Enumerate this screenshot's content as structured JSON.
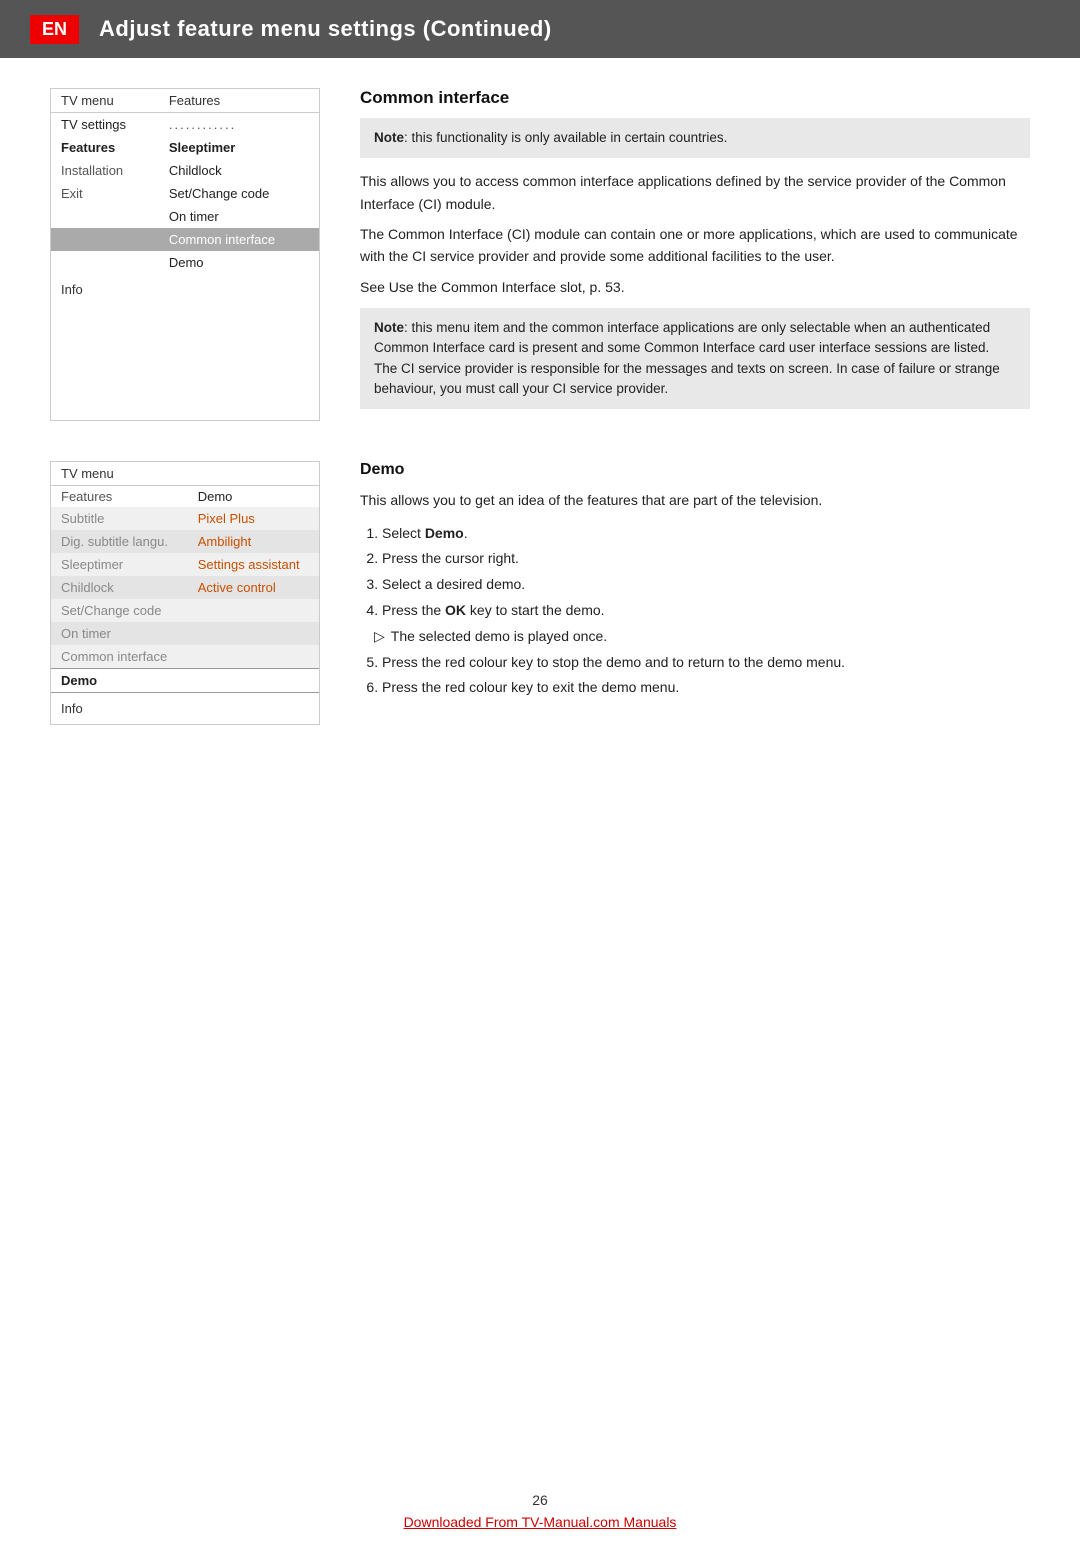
{
  "header": {
    "en_label": "EN",
    "title": "Adjust feature menu settings  (Continued)"
  },
  "section1": {
    "menu": {
      "header": [
        "TV menu",
        "Features"
      ],
      "rows": [
        {
          "left": "TV settings",
          "right": "............",
          "style": "dots"
        },
        {
          "left": "Features",
          "right": "Sleeptimer",
          "style": "features-selected"
        },
        {
          "left": "Installation",
          "right": "Childlock",
          "style": "normal"
        },
        {
          "left": "Exit",
          "right": "Set/Change code",
          "style": "normal"
        },
        {
          "left": "",
          "right": "On timer",
          "style": "normal"
        },
        {
          "left": "",
          "right": "Common interface",
          "style": "highlight"
        },
        {
          "left": "",
          "right": "Demo",
          "style": "normal"
        },
        {
          "left": "Info",
          "right": "",
          "style": "info"
        }
      ]
    },
    "heading": "Common interface",
    "note1": {
      "label": "Note",
      "text": ": this functionality is only available in certain countries."
    },
    "para1": "This allows you to access common interface applications defined by the service provider of the Common Interface (CI) module.",
    "para2": "The Common Interface (CI) module can contain one or more applications, which are used to communicate with the CI service provider and provide some additional facilities to the user.",
    "para3": "See Use the Common Interface slot, p. 53.",
    "note2": {
      "label": "Note",
      "text": ": this menu item and the common interface applications are only selectable when an authenticated Common Interface card is present and some Common Interface card user interface sessions are listed. The CI service provider is responsible for the messages and texts on screen. In case of failure or strange behaviour, you must call your CI service provider."
    }
  },
  "section2": {
    "menu": {
      "header": [
        "TV menu",
        ""
      ],
      "subheader": [
        "Features",
        "Demo"
      ],
      "rows": [
        {
          "left": "Subtitle",
          "right": "Pixel Plus",
          "style": "stripe-a"
        },
        {
          "left": "Dig. subtitle langu.",
          "right": "Ambilight",
          "style": "stripe-b"
        },
        {
          "left": "Sleeptimer",
          "right": "Settings assistant",
          "style": "stripe-a"
        },
        {
          "left": "Childlock",
          "right": "Active control",
          "style": "stripe-b"
        },
        {
          "left": "Set/Change code",
          "right": "",
          "style": "stripe-a"
        },
        {
          "left": "On timer",
          "right": "",
          "style": "stripe-b"
        },
        {
          "left": "Common interface",
          "right": "",
          "style": "stripe-a"
        },
        {
          "left": "Demo",
          "right": "",
          "style": "demo-selected"
        },
        {
          "left": "Info",
          "right": "",
          "style": "info"
        }
      ]
    },
    "heading": "Demo",
    "para1": "This allows you to get an idea of the features that are part of the television.",
    "steps": [
      {
        "num": "1.",
        "text": "Select ",
        "bold": "Demo",
        "after": "."
      },
      {
        "num": "2.",
        "text": "Press the cursor right.",
        "bold": "",
        "after": ""
      },
      {
        "num": "3.",
        "text": "Select a desired demo.",
        "bold": "",
        "after": ""
      },
      {
        "num": "4.",
        "text": "Press the ",
        "bold": "OK",
        "after": " key to start the demo."
      },
      {
        "num": "▷",
        "text": "The selected demo is played once.",
        "bold": "",
        "after": ""
      },
      {
        "num": "5.",
        "text": "Press the red colour key to stop the demo and to return to the demo menu.",
        "bold": "",
        "after": ""
      },
      {
        "num": "6.",
        "text": "Press the red colour key to exit the demo menu.",
        "bold": "",
        "after": ""
      }
    ]
  },
  "footer": {
    "page_number": "26",
    "link_text": "Downloaded From TV-Manual.com Manuals"
  }
}
